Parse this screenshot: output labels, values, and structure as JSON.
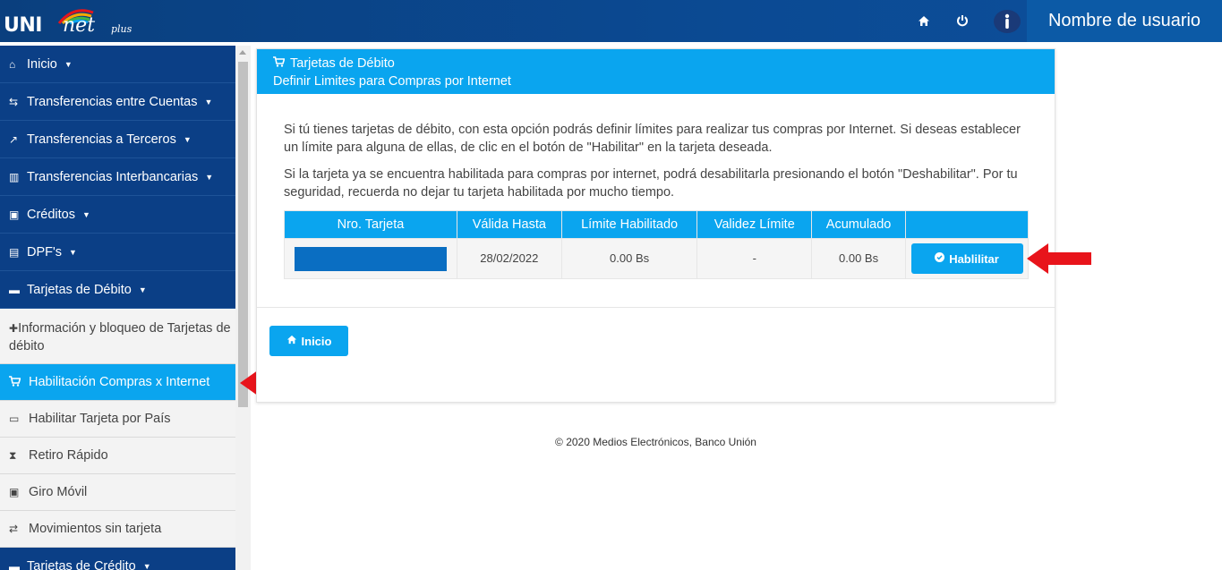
{
  "header": {
    "logo_uni": "UNI",
    "logo_net": "net",
    "logo_plus": "plus",
    "home_icon": "home-icon",
    "power_icon": "power-icon",
    "user_icon": "user-icon",
    "username": "Nombre de usuario"
  },
  "sidebar": {
    "items": [
      {
        "label": "Inicio",
        "icon": "home-icon"
      },
      {
        "label": "Transferencias entre Cuentas",
        "icon": "exchange-icon"
      },
      {
        "label": "Transferencias a Terceros",
        "icon": "external-link-icon"
      },
      {
        "label": "Transferencias Interbancarias",
        "icon": "bank-icon"
      },
      {
        "label": "Créditos",
        "icon": "money-icon"
      },
      {
        "label": "DPF's",
        "icon": "calculator-icon"
      },
      {
        "label": "Tarjetas de Débito",
        "icon": "credit-card-icon"
      }
    ],
    "subitems": [
      {
        "label": "Información y bloqueo de Tarjetas de débito",
        "icon": "plus-icon"
      },
      {
        "label": "Habilitación Compras x Internet",
        "icon": "cart-icon"
      },
      {
        "label": "Habilitar Tarjeta por País",
        "icon": "credit-card-icon"
      },
      {
        "label": "Retiro Rápido",
        "icon": "hourglass-icon"
      },
      {
        "label": "Giro Móvil",
        "icon": "money-icon"
      },
      {
        "label": "Movimientos sin tarjeta",
        "icon": "exchange-icon"
      }
    ],
    "last_item": {
      "label": "Tarjetas de Crédito",
      "icon": "credit-card-icon"
    }
  },
  "panel": {
    "title": "Tarjetas de Débito",
    "subtitle": "Definir Limites para Compras por Internet",
    "paragraph1": "Si tú tienes tarjetas de débito, con esta opción podrás definir límites para realizar tus compras por Internet. Si deseas establecer un límite para alguna de ellas, de clic en el botón de \"Habilitar\" en la tarjeta deseada.",
    "paragraph2": "Si la tarjeta ya se encuentra habilitada para compras por internet, podrá desabilitarla presionando el botón \"Deshabilitar\". Por tu seguridad, recuerda no dejar tu tarjeta habilitada por mucho tiempo.",
    "table": {
      "headers": [
        "Nro. Tarjeta",
        "Válida Hasta",
        "Límite Habilitado",
        "Validez Límite",
        "Acumulado",
        ""
      ],
      "rows": [
        {
          "card": "",
          "valid_until": "28/02/2022",
          "limit": "0.00 Bs",
          "validity": "-",
          "accumulated": "0.00 Bs",
          "action": "Hablilitar"
        }
      ]
    },
    "home_button": "Inicio"
  },
  "footer": "© 2020 Medios Electrónicos, Banco Unión",
  "colors": {
    "header_bg": "#0b4a93",
    "sidebar_bg": "#0b3f86",
    "accent": "#0aa5ef",
    "masked_card": "#0a6ec2",
    "arrow": "#e8141b"
  }
}
